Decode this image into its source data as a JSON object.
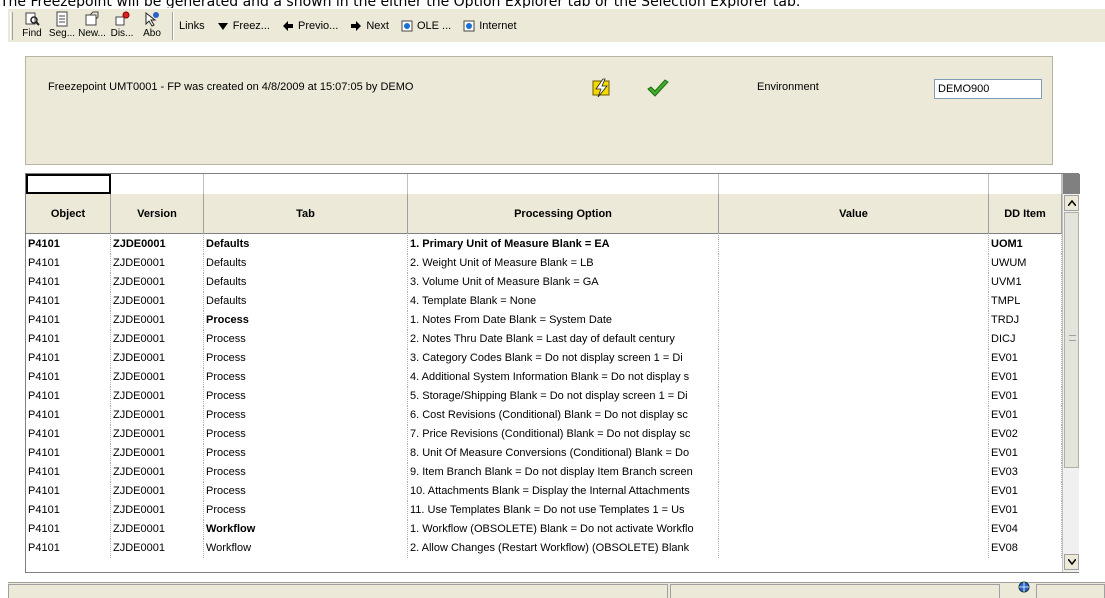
{
  "top_note": "The Freezepoint will be generated and a shown in the either the Option Explorer tab or the Selection Explorer tab.",
  "toolbar": {
    "find": "Find",
    "seg": "Seg...",
    "new": "New...",
    "dis": "Dis...",
    "abo": "Abo",
    "links": "Links",
    "freez": "Freez...",
    "previous": "Previo...",
    "next": "Next",
    "ole": "OLE ...",
    "internet": "Internet"
  },
  "header": {
    "message": "Freezepoint UMT0001 - FP was created on 4/8/2009 at 15:07:05 by DEMO",
    "environment_label": "Environment",
    "environment_value": "DEMO900"
  },
  "grid": {
    "columns": [
      "Object",
      "Version",
      "Tab",
      "Processing Option",
      "Value",
      "DD Item"
    ],
    "rows": [
      {
        "object": "P4101",
        "version": "ZJDE0001",
        "tab": "Defaults",
        "po": "1.  Primary Unit of Measure    Blank = EA",
        "value": "",
        "dd": "UOM1",
        "bold": true
      },
      {
        "object": "P4101",
        "version": "ZJDE0001",
        "tab": "Defaults",
        "po": "2. Weight Unit of Measure    Blank = LB",
        "value": "",
        "dd": "UWUM",
        "bold": false
      },
      {
        "object": "P4101",
        "version": "ZJDE0001",
        "tab": "Defaults",
        "po": "3. Volume Unit of Measure   Blank = GA",
        "value": "",
        "dd": "UVM1",
        "bold": false
      },
      {
        "object": "P4101",
        "version": "ZJDE0001",
        "tab": "Defaults",
        "po": "4. Template   Blank = None",
        "value": "",
        "dd": "TMPL",
        "bold": false
      },
      {
        "object": "P4101",
        "version": "ZJDE0001",
        "tab": "Process",
        "po": "1.  Notes From Date    Blank = System Date",
        "value": "",
        "dd": "TRDJ",
        "bold": false,
        "tab_bold": true
      },
      {
        "object": "P4101",
        "version": "ZJDE0001",
        "tab": "Process",
        "po": "2.  Notes Thru Date    Blank = Last day of default century",
        "value": "",
        "dd": "DICJ",
        "bold": false
      },
      {
        "object": "P4101",
        "version": "ZJDE0001",
        "tab": "Process",
        "po": "3.  Category Codes    Blank = Do not display screen  1 = Di",
        "value": "",
        "dd": "EV01",
        "bold": false
      },
      {
        "object": "P4101",
        "version": "ZJDE0001",
        "tab": "Process",
        "po": "4. Additional System Information   Blank = Do not display s",
        "value": "",
        "dd": "EV01",
        "bold": false
      },
      {
        "object": "P4101",
        "version": "ZJDE0001",
        "tab": "Process",
        "po": "5.  Storage/Shipping    Blank = Do not display screen  1 = Di",
        "value": "",
        "dd": "EV01",
        "bold": false
      },
      {
        "object": "P4101",
        "version": "ZJDE0001",
        "tab": "Process",
        "po": "6.  Cost Revisions (Conditional)   Blank = Do not display sc",
        "value": "",
        "dd": "EV01",
        "bold": false
      },
      {
        "object": "P4101",
        "version": "ZJDE0001",
        "tab": "Process",
        "po": "7.  Price Revisions (Conditional)    Blank = Do not display sc",
        "value": "",
        "dd": "EV02",
        "bold": false
      },
      {
        "object": "P4101",
        "version": "ZJDE0001",
        "tab": "Process",
        "po": "8. Unit Of Measure Conversions (Conditional)   Blank = Do",
        "value": "",
        "dd": "EV01",
        "bold": false
      },
      {
        "object": "P4101",
        "version": "ZJDE0001",
        "tab": "Process",
        "po": "9.  Item Branch   Blank = Do not display Item Branch screen",
        "value": "",
        "dd": "EV03",
        "bold": false
      },
      {
        "object": "P4101",
        "version": "ZJDE0001",
        "tab": "Process",
        "po": "10.  Attachments   Blank = Display the Internal Attachments",
        "value": "",
        "dd": "EV01",
        "bold": false
      },
      {
        "object": "P4101",
        "version": "ZJDE0001",
        "tab": "Process",
        "po": "11. Use Templates   Blank = Do not use Templates  1 = Us",
        "value": "",
        "dd": "EV01",
        "bold": false
      },
      {
        "object": "P4101",
        "version": "ZJDE0001",
        "tab": "Workflow",
        "po": "1.  Workflow (OBSOLETE)    Blank = Do not activate Workflo",
        "value": "",
        "dd": "EV04",
        "bold": false,
        "tab_bold": true
      },
      {
        "object": "P4101",
        "version": "ZJDE0001",
        "tab": "Workflow",
        "po": "2.  Allow Changes (Restart Workflow) (OBSOLETE)   Blank",
        "value": "",
        "dd": "EV08",
        "bold": false
      }
    ]
  },
  "colors": {
    "panel": "#ece9d8",
    "check_green": "#3fae2a",
    "bolt_yellow": "#f5d800"
  }
}
